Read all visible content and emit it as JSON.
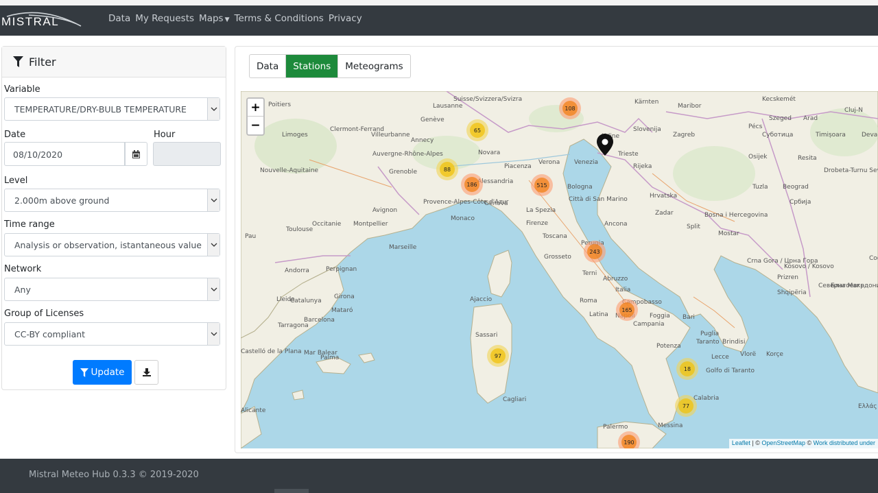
{
  "brand": {
    "name": "MISTRAL"
  },
  "nav": [
    {
      "label": "Data"
    },
    {
      "label": "My Requests"
    },
    {
      "label": "Maps"
    },
    {
      "label": "Terms & Conditions"
    },
    {
      "label": "Privacy"
    }
  ],
  "filter": {
    "title": "Filter",
    "variable_label": "Variable",
    "variable_value": "TEMPERATURE/DRY-BULB TEMPERATURE",
    "date_label": "Date",
    "date_value": "08/10/2020",
    "hour_label": "Hour",
    "hour_value": "",
    "level_label": "Level",
    "level_value": "2.000m above ground",
    "timerange_label": "Time range",
    "timerange_value": "Analysis or observation, istantaneous value",
    "network_label": "Network",
    "network_value": "Any",
    "license_label": "Group of Licenses",
    "license_value": "CC-BY compliant",
    "update_label": "Update"
  },
  "tabs": [
    {
      "label": "Data",
      "active": false
    },
    {
      "label": "Stations",
      "active": true
    },
    {
      "label": "Meteograms",
      "active": false
    }
  ],
  "map": {
    "places": [
      "Poitiers",
      "Limoges",
      "Clermont-Ferrand",
      "Villeurbanne",
      "Annecy",
      "Genève",
      "Lausanne",
      "Suisse/Svizzera/Svizra",
      "Kärnten",
      "Maribor",
      "Kecskemét",
      "Szeged",
      "Arad",
      "Cluj-N",
      "Pécs",
      "Суботица",
      "Timișoara",
      "Deva",
      "Slovenija",
      "Zagreb",
      "Udine",
      "Trieste",
      "Rijeka",
      "Osijek",
      "Resita",
      "Drobeta-Turnu Severin",
      "Beograd",
      "Србија",
      "Venezia",
      "Verona",
      "Novara",
      "Piacenza",
      "Grenoble",
      "Auvergne-Rhône-Alpes",
      "Nouvelle-Aquitaine",
      "Alessandria",
      "Genova",
      "Bologna",
      "Città di San Marino",
      "Hrvatska",
      "Zadar",
      "Tuzla",
      "Bosna i Hercegovina",
      "Avignon",
      "Monaco",
      "Provence-Alpes-Côte d'Azur",
      "La Spezia",
      "Firenze",
      "Ancona",
      "Split",
      "Mostar",
      "Toulouse",
      "Occitanie",
      "Montpellier",
      "Marseille",
      "Pau",
      "Toscana",
      "Perugia",
      "Grosseto",
      "Crna Gora / Црна Гора",
      "Kosovo / Kosovo",
      "Prizren",
      "Софи",
      "Andorra",
      "Perpignan",
      "Terni",
      "Abruzzo",
      "Italia",
      "Shqipëria",
      "Северна Македонија",
      "Благоевгр",
      "Girona",
      "Lleida",
      "Catalunya",
      "Mataró",
      "Barcelona",
      "Ajaccio",
      "Roma",
      "Campobasso",
      "Foggia",
      "Bari",
      "Latina",
      "Napoli",
      "Campania",
      "Tarragona",
      "Sassari",
      "Potenza",
      "Taranto",
      "Brindisi",
      "Lecce",
      "Vlorë",
      "Puglia",
      "Korçe",
      "Castelló de la Plana",
      "Mar Balear",
      "Palma",
      "Golfo di Taranto",
      "Cagliari",
      "Calabria",
      "Palermo",
      "Messina",
      "Ελλάς",
      "Alicante"
    ],
    "clusters": [
      {
        "count": "108",
        "color": "orange"
      },
      {
        "count": "65",
        "color": "yellow"
      },
      {
        "count": "88",
        "color": "yellow"
      },
      {
        "count": "186",
        "color": "orange"
      },
      {
        "count": "515",
        "color": "orange"
      },
      {
        "count": "243",
        "color": "orange"
      },
      {
        "count": "165",
        "color": "orange"
      },
      {
        "count": "97",
        "color": "yellow"
      },
      {
        "count": "18",
        "color": "yellow"
      },
      {
        "count": "77",
        "color": "yellow"
      },
      {
        "count": "190",
        "color": "orange"
      }
    ],
    "zoom_in": "+",
    "zoom_out": "−",
    "attribution": {
      "leaflet": "Leaflet",
      "sep": " | © ",
      "osm": "OpenStreetMap",
      "mid": " © ",
      "work": "Work distributed under"
    }
  },
  "footer": {
    "text": "Mistral Meteo Hub 0.3.3 © 2019-2020"
  }
}
